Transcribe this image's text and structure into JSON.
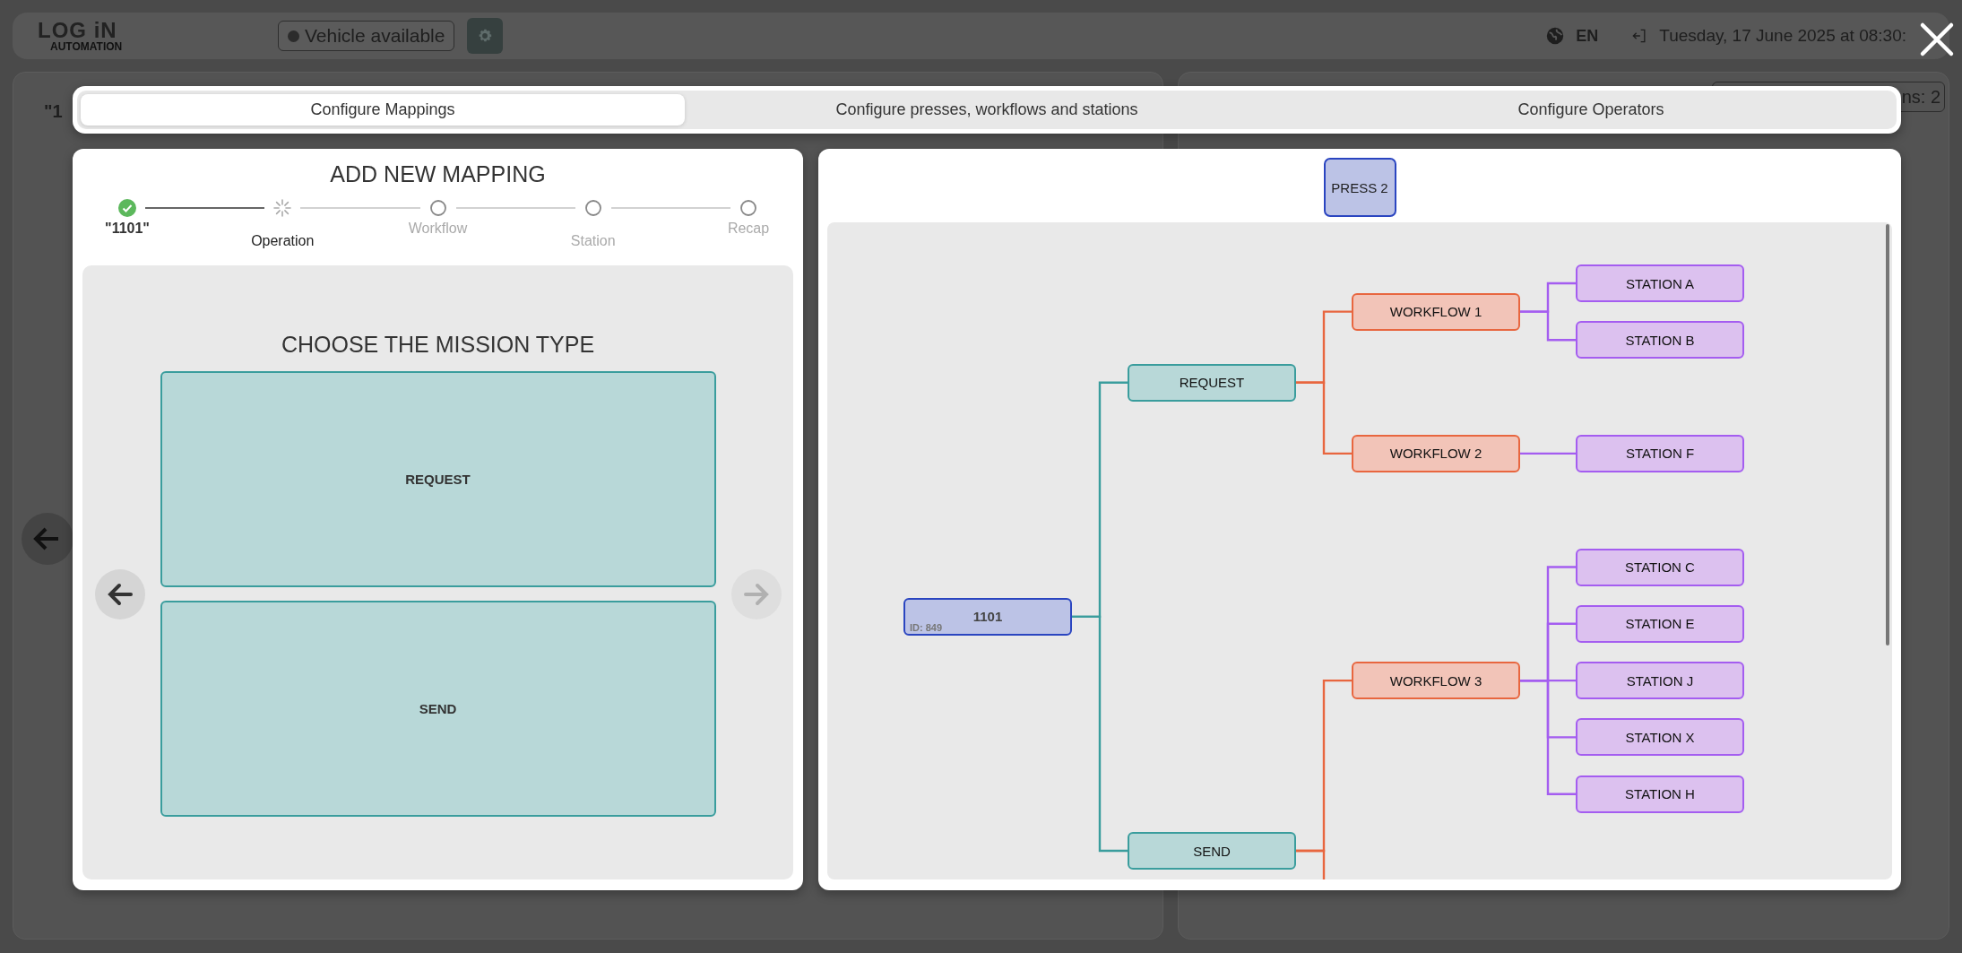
{
  "header": {
    "logo": {
      "title": "LOG iN",
      "subtitle": "AUTOMATION"
    },
    "vehicle_status": "Vehicle available",
    "language": "EN",
    "datetime": "Tuesday, 17 June 2025 at 08:30:"
  },
  "background": {
    "order_label": "\"1",
    "badge": "ns: 2"
  },
  "modal": {
    "tabs": [
      {
        "label": "Configure Mappings",
        "selected": true
      },
      {
        "label": "Configure presses, workflows and stations",
        "selected": false
      },
      {
        "label": "Configure Operators",
        "selected": false
      }
    ],
    "mapping": {
      "title": "ADD NEW MAPPING",
      "steps": [
        {
          "label": "\"1101\"",
          "done": true,
          "current": false
        },
        {
          "label": "Operation",
          "done": false,
          "current": true
        },
        {
          "label": "Workflow",
          "done": false,
          "current": false
        },
        {
          "label": "Station",
          "done": false,
          "current": false
        },
        {
          "label": "Recap",
          "done": false,
          "current": false
        }
      ],
      "prompt": "CHOOSE THE MISSION TYPE",
      "options": [
        {
          "label": "REQUEST",
          "selected": false
        },
        {
          "label": "SEND",
          "selected": false
        }
      ],
      "prev_button": {
        "disabled": false
      },
      "next_button": {
        "disabled": true
      }
    },
    "diagram": {
      "press": "PRESS 2",
      "root": {
        "label": "1101",
        "id_label": "ID: 849",
        "kind": "mapping",
        "children": [
          {
            "label": "REQUEST",
            "kind": "operation",
            "children": [
              {
                "label": "WORKFLOW 1",
                "kind": "workflow",
                "children": [
                  {
                    "label": "STATION A",
                    "kind": "station"
                  },
                  {
                    "label": "STATION B",
                    "kind": "station"
                  }
                ]
              },
              {
                "label": "WORKFLOW 2",
                "kind": "workflow",
                "children": [
                  {
                    "label": "STATION F",
                    "kind": "station"
                  }
                ]
              }
            ]
          },
          {
            "label": "SEND",
            "kind": "operation",
            "more_below": true,
            "children": [
              {
                "label": "WORKFLOW 3",
                "kind": "workflow",
                "children": [
                  {
                    "label": "STATION C",
                    "kind": "station"
                  },
                  {
                    "label": "STATION E",
                    "kind": "station"
                  },
                  {
                    "label": "STATION J",
                    "kind": "station"
                  },
                  {
                    "label": "STATION X",
                    "kind": "station"
                  },
                  {
                    "label": "STATION H",
                    "kind": "station"
                  }
                ]
              }
            ]
          }
        ]
      }
    }
  }
}
